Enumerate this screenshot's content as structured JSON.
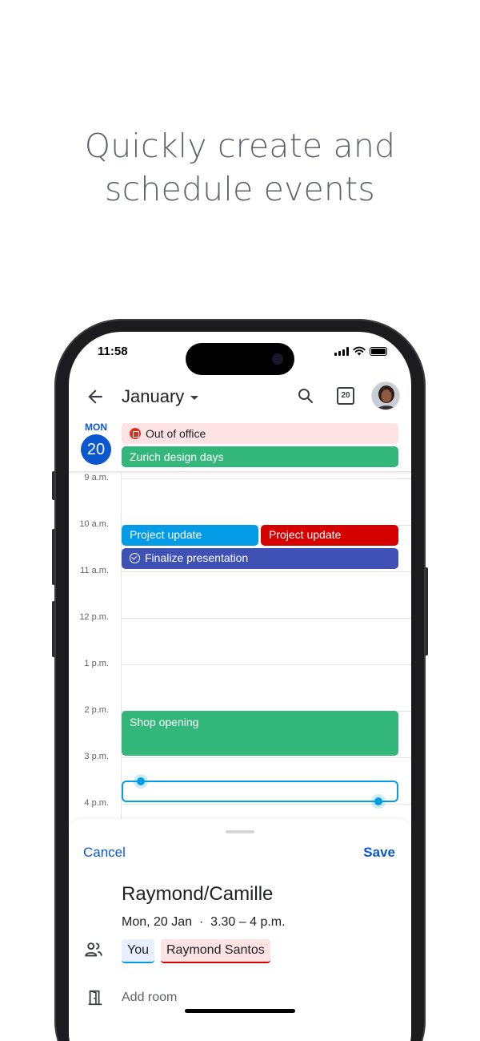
{
  "headline": {
    "line1": "Quickly create and",
    "line2": "schedule events"
  },
  "status": {
    "time": "11:58"
  },
  "appbar": {
    "month": "January",
    "today_day": "20"
  },
  "day": {
    "dow": "MON",
    "num": "20"
  },
  "all_day_events": [
    {
      "label": "Out of office",
      "color": "#fde3e3",
      "icon": "out-of-office-icon"
    },
    {
      "label": "Zurich design days",
      "color": "#33b679"
    }
  ],
  "hours": [
    "9 a.m.",
    "10 a.m.",
    "11 a.m.",
    "12 p.m.",
    "1 p.m.",
    "2 p.m.",
    "3 p.m.",
    "4 p.m."
  ],
  "events": [
    {
      "label": "Project update",
      "color": "#039be5"
    },
    {
      "label": "Project update",
      "color": "#d50000"
    },
    {
      "label": "Finalize presentation",
      "color": "#3f51b5",
      "icon": "task-check-icon"
    },
    {
      "label": "Shop opening",
      "color": "#33b679"
    }
  ],
  "sheet": {
    "cancel": "Cancel",
    "save": "Save",
    "title": "Raymond/Camille",
    "when": "Mon, 20 Jan  ·  3.30 – 4 p.m.",
    "guests": [
      "You",
      "Raymond Santos"
    ],
    "add_room": "Add room"
  },
  "colors": {
    "accent": "#0b57d0",
    "headline": "#5f6368"
  }
}
